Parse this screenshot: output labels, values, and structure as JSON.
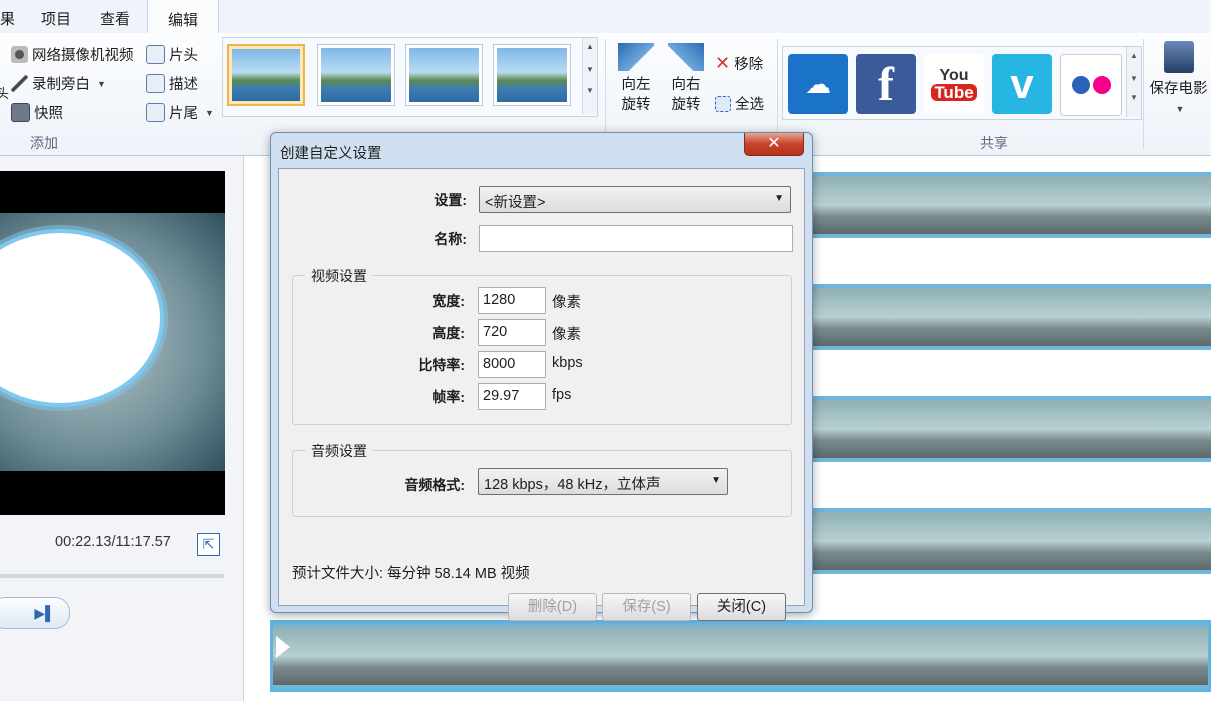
{
  "menubar": {
    "items": [
      "果",
      "项目",
      "查看",
      "编辑"
    ]
  },
  "ribbon": {
    "add_group": {
      "label": "添加",
      "webcam": "网络摄像机视频",
      "narration": "录制旁白",
      "snapshot": "快照",
      "title": "片头",
      "caption": "描述",
      "credits": "片尾",
      "edge_char": "头"
    },
    "rotate_left": [
      "向左",
      "旋转"
    ],
    "rotate_right": [
      "向右",
      "旋转"
    ],
    "remove": "移除",
    "select_all": "全选",
    "share_group": {
      "label": "共享",
      "icons": [
        "onedrive",
        "facebook",
        "youtube",
        "vimeo",
        "flickr"
      ]
    },
    "save_movie": "保存电影"
  },
  "preview": {
    "timecode": "00:22.13/11:17.57"
  },
  "dialog": {
    "title": "创建自定义设置",
    "close": "✕",
    "settings_label": "设置:",
    "settings_value": "<新设置>",
    "name_label": "名称:",
    "name_value": "",
    "video": {
      "legend": "视频设置",
      "width_label": "宽度:",
      "width_value": "1280",
      "width_unit": "像素",
      "height_label": "高度:",
      "height_value": "720",
      "height_unit": "像素",
      "bitrate_label": "比特率:",
      "bitrate_value": "8000",
      "bitrate_unit": "kbps",
      "framerate_label": "帧率:",
      "framerate_value": "29.97",
      "framerate_unit": "fps"
    },
    "audio": {
      "legend": "音频设置",
      "format_label": "音频格式:",
      "format_value": "128 kbps，48 kHz，立体声"
    },
    "estimate": "预计文件大小: 每分钟 58.14 MB 视频",
    "buttons": {
      "delete": "删除(D)",
      "save": "保存(S)",
      "close": "关闭(C)"
    }
  },
  "colors": {
    "accent": "#2a6bb4",
    "track_border": "#73b4d9",
    "close_red": "#c7432b"
  }
}
